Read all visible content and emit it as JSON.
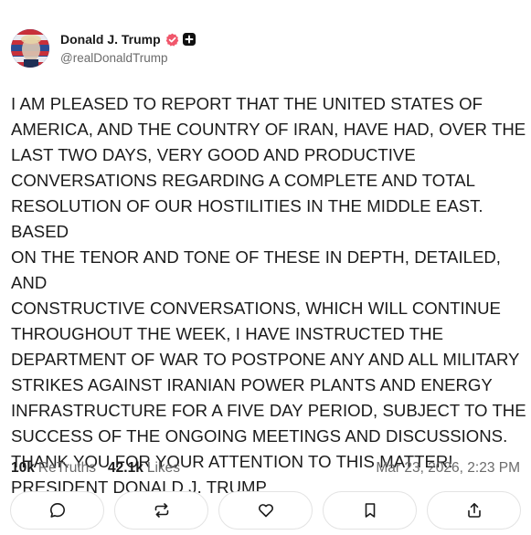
{
  "author": {
    "display_name": "Donald J. Trump",
    "handle": "@realDonaldTrump"
  },
  "post": {
    "text": "I AM PLEASED TO REPORT THAT THE UNITED STATES OF\nAMERICA, AND THE COUNTRY OF IRAN, HAVE HAD, OVER THE\nLAST TWO DAYS, VERY GOOD AND PRODUCTIVE\nCONVERSATIONS REGARDING A COMPLETE AND TOTAL\nRESOLUTION OF OUR HOSTILITIES IN THE MIDDLE EAST. BASED\nON THE TENOR AND TONE OF THESE IN DEPTH, DETAILED, AND\nCONSTRUCTIVE CONVERSATIONS, WHICH WILL CONTINUE\nTHROUGHOUT THE WEEK, I HAVE INSTRUCTED THE\nDEPARTMENT OF WAR TO POSTPONE ANY AND ALL MILITARY\nSTRIKES AGAINST IRANIAN POWER PLANTS AND ENERGY\nINFRASTRUCTURE FOR A FIVE DAY PERIOD, SUBJECT TO THE\nSUCCESS OF THE ONGOING MEETINGS AND DISCUSSIONS.\nTHANK YOU FOR YOUR ATTENTION TO THIS MATTER!\nPRESIDENT DONALD J. TRUMP"
  },
  "stats": {
    "retruths_count": "10k",
    "retruths_label": "ReTruths",
    "likes_count": "42.1k",
    "likes_label": "Likes",
    "timestamp": "Mar 23, 2026, 2:23 PM"
  },
  "actions": [
    {
      "icon": "reply-icon"
    },
    {
      "icon": "retruth-icon"
    },
    {
      "icon": "heart-icon"
    },
    {
      "icon": "bookmark-icon"
    },
    {
      "icon": "share-icon"
    }
  ],
  "colors": {
    "verified": "#f0566b",
    "text": "#1a1a1a",
    "muted": "#6b6b6b",
    "border": "#e3e3e3"
  }
}
